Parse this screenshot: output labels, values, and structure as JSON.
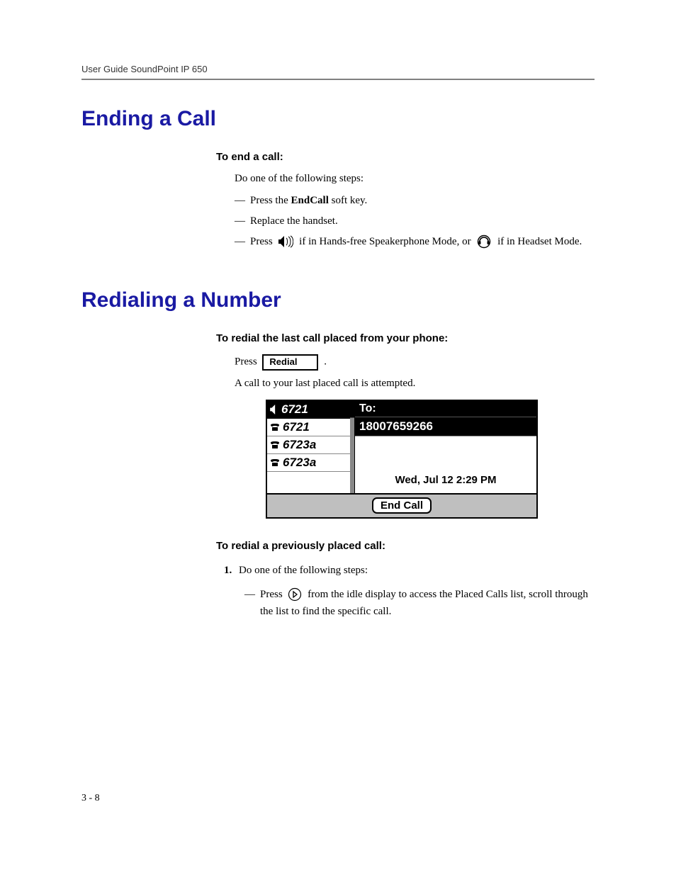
{
  "header": {
    "running_head": "User Guide SoundPoint IP 650"
  },
  "sections": {
    "end_call": {
      "heading": "Ending a Call",
      "sub": "To end a call:",
      "lead": "Do one of the following steps:",
      "item1_pre": "Press the ",
      "item1_bold": "EndCall",
      "item1_post": " soft key.",
      "item2": "Replace the handset.",
      "item3_pre": "Press ",
      "item3_mid": " if in Hands-free Speakerphone Mode, or ",
      "item3_post": " if in Headset Mode."
    },
    "redial": {
      "heading": "Redialing a Number",
      "sub1": "To redial the last call placed from your phone:",
      "press_label": "Press ",
      "redial_key_label": "Redial",
      "press_tail": " .",
      "result": "A call to your last placed call is attempted.",
      "sub2": "To redial a previously placed call:",
      "step1": "Do one of the following steps:",
      "step1a_pre": "Press ",
      "step1a_post": " from the idle display to access the Placed Calls list, scroll through the list to find the specific call."
    }
  },
  "phone_screen": {
    "lines": [
      {
        "label": "6721",
        "active": true,
        "icon": "speaker"
      },
      {
        "label": "6721",
        "active": false,
        "icon": "phone"
      },
      {
        "label": "6723a",
        "active": false,
        "icon": "phone"
      },
      {
        "label": "6723a",
        "active": false,
        "icon": "phone"
      }
    ],
    "to_label": "To:",
    "dialed_number": "18007659266",
    "datetime": "Wed, Jul 12  2:29 PM",
    "softkey": "End Call"
  },
  "footer": {
    "page_num": "3 - 8"
  }
}
